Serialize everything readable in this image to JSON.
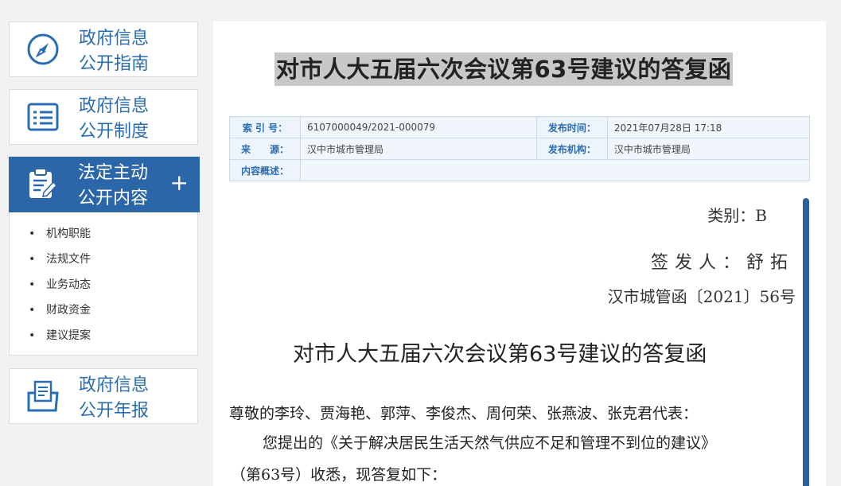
{
  "sidebar": {
    "guide": {
      "label": "政府信息\n公开指南",
      "icon": "compass-icon"
    },
    "system": {
      "label": "政府信息\n公开制度",
      "icon": "list-document-icon"
    },
    "active": {
      "label": "法定主动\n公开内容",
      "icon": "clipboard-edit-icon",
      "expand": "+",
      "items": [
        {
          "label": "机构职能"
        },
        {
          "label": "法规文件"
        },
        {
          "label": "业务动态"
        },
        {
          "label": "财政资金"
        },
        {
          "label": "建议提案"
        }
      ]
    },
    "annual": {
      "label": "政府信息\n公开年报",
      "icon": "folder-document-icon"
    }
  },
  "main": {
    "page_title": "对市人大五届六次会议第63号建议的答复函",
    "meta": {
      "index_label": "索 引 号：",
      "index_value": "6107000049/2021-000079",
      "pubtime_label": "发布时间：",
      "pubtime_value": "2021年07月28日 17:18",
      "source_label": "来　　源：",
      "source_value": "汉中市城市管理局",
      "org_label": "发布机构：",
      "org_value": "汉中市城市管理局",
      "summary_label": "内容概述：",
      "summary_value": ""
    },
    "doc": {
      "category": "类别：B",
      "signer": "签发人：舒拓",
      "doc_number": "汉市城管函〔2021〕56号",
      "title": "对市人大五届六次会议第63号建议的答复函",
      "greeting": "尊敬的李玲、贾海艳、郭萍、李俊杰、周何荣、张燕波、张克君代表：",
      "para1": "您提出的《关于解决居民生活天然气供应不足和管理不到位的建议》",
      "para2": "（第63号）收悉，现答复如下："
    }
  },
  "colors": {
    "accent": "#2b66a8",
    "link": "#2a6db3",
    "bg": "#f2f2f2"
  }
}
